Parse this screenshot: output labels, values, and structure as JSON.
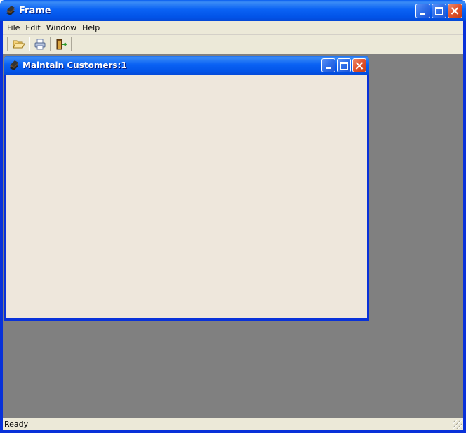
{
  "window": {
    "title": "Frame",
    "icon": "app-icon",
    "buttons": [
      "minimize-icon",
      "maximize-icon",
      "close-icon"
    ]
  },
  "menubar": {
    "items": [
      {
        "label": "File"
      },
      {
        "label": "Edit"
      },
      {
        "label": "Window"
      },
      {
        "label": "Help"
      }
    ]
  },
  "toolbar": {
    "buttons": [
      {
        "icon": "open-folder-icon"
      },
      {
        "icon": "print-icon"
      },
      {
        "icon": "exit-icon"
      }
    ]
  },
  "child_window": {
    "title": "Maintain Customers:1",
    "icon": "app-icon"
  },
  "status": {
    "text": "Ready"
  },
  "colors": {
    "titlebar": "#0a62f4",
    "close_button": "#e0522c",
    "mdi_background": "#808080",
    "client": "#ece9d8"
  }
}
